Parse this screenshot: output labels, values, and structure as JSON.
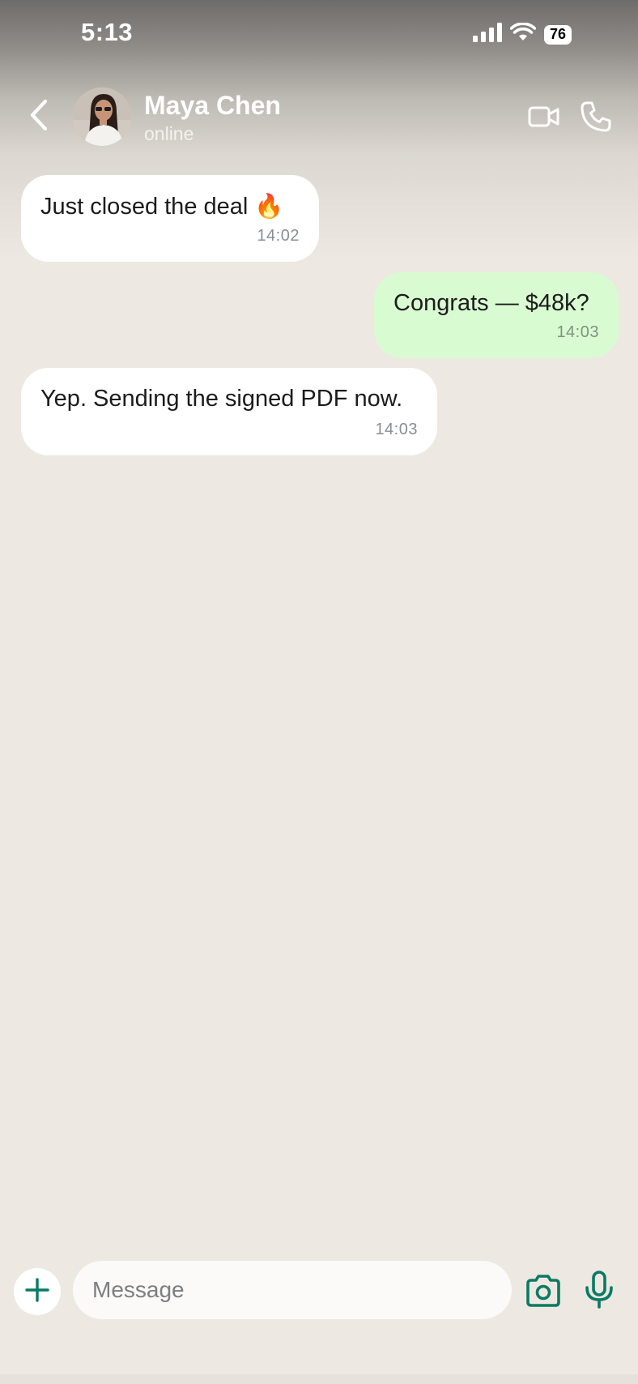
{
  "status_bar": {
    "time": "5:13",
    "battery": "76"
  },
  "header": {
    "contact_name": "Maya Chen",
    "contact_status": "online",
    "icons": {
      "back": "chevron-left-icon",
      "video": "video-camera-icon",
      "call": "phone-icon"
    }
  },
  "messages": [
    {
      "direction": "incoming",
      "text": "Just closed the deal 🔥",
      "time": "14:02"
    },
    {
      "direction": "outgoing",
      "text": "Congrats — $48k?",
      "time": "14:03"
    },
    {
      "direction": "incoming",
      "text": "Yep. Sending the signed PDF now.",
      "time": "14:03"
    }
  ],
  "composer": {
    "placeholder": "Message",
    "value": "",
    "icons": {
      "attach": "plus-icon",
      "camera": "camera-icon",
      "mic": "microphone-icon"
    }
  },
  "colors": {
    "chat_background": "#ede9e2",
    "incoming_bubble": "#ffffff",
    "outgoing_bubble": "#d9fbd1",
    "accent": "#0a7a63"
  }
}
